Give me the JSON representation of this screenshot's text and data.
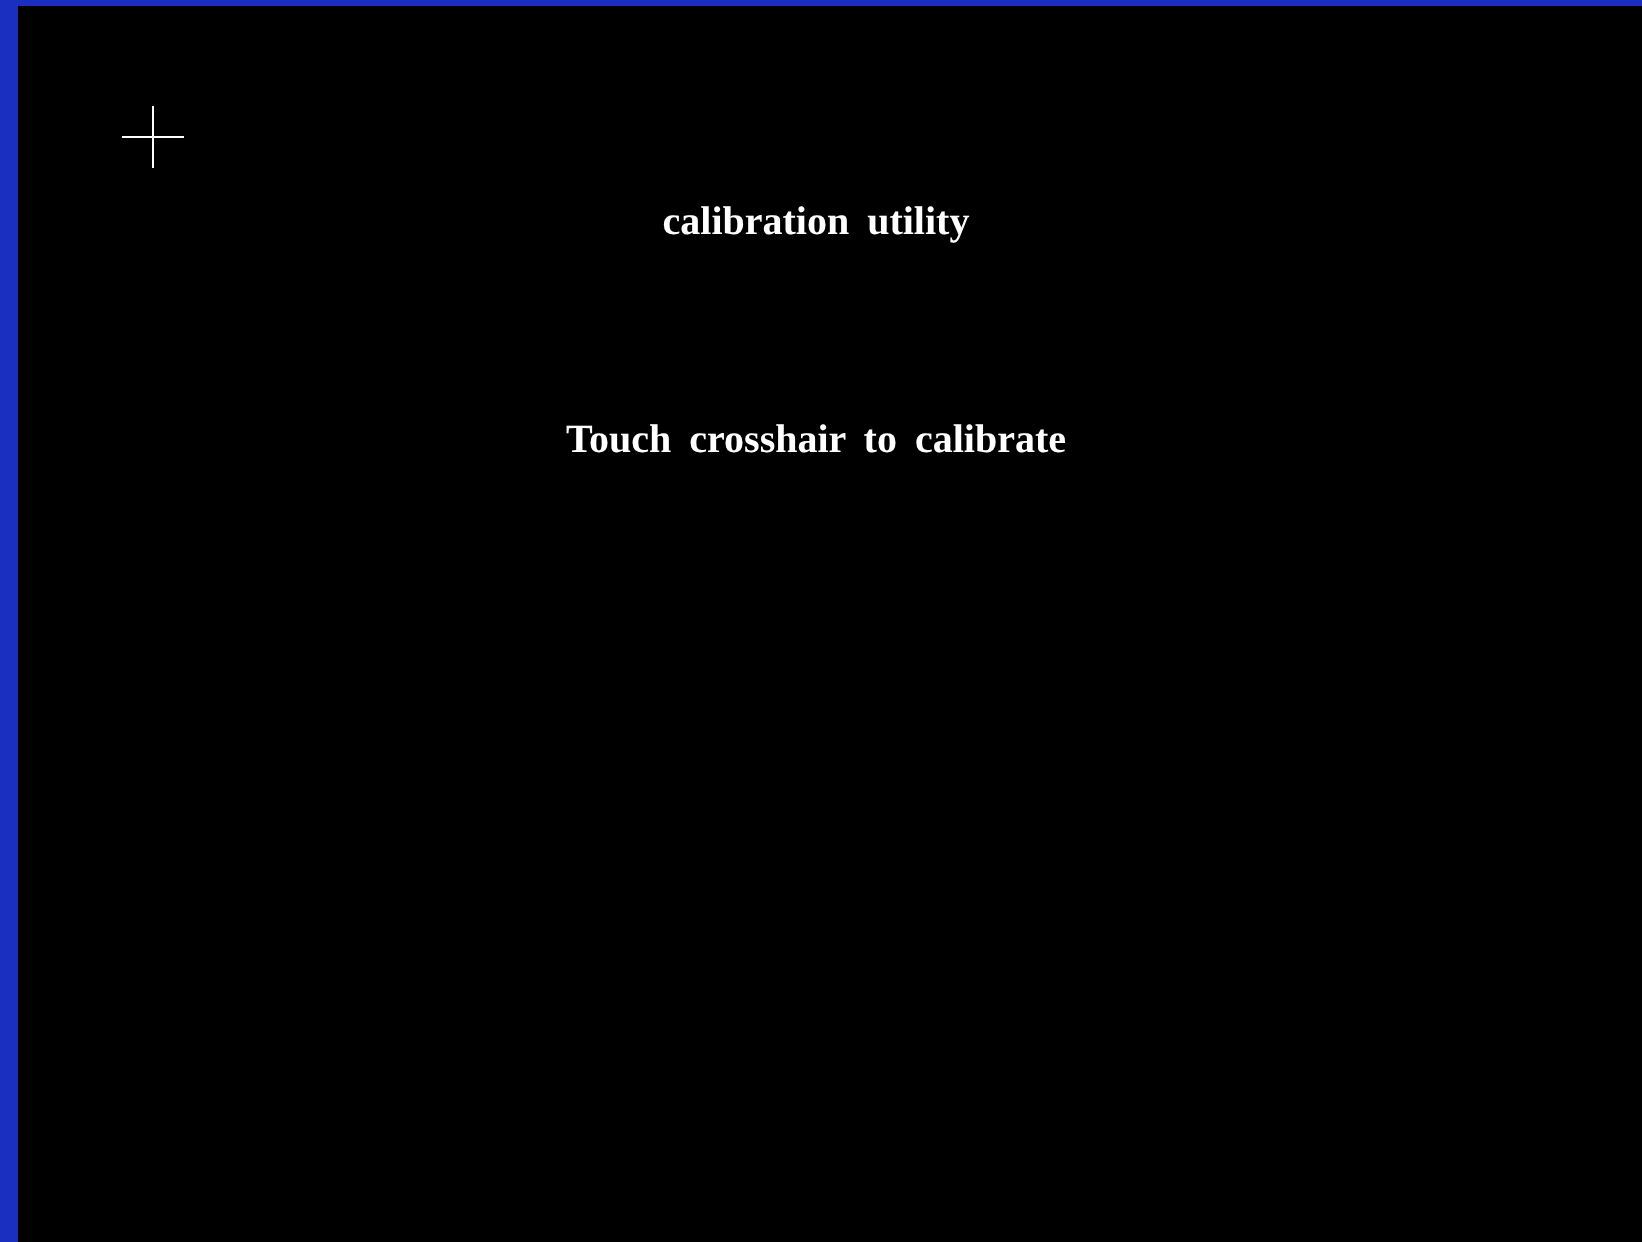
{
  "title": "calibration utility",
  "instruction": "Touch crosshair to calibrate"
}
